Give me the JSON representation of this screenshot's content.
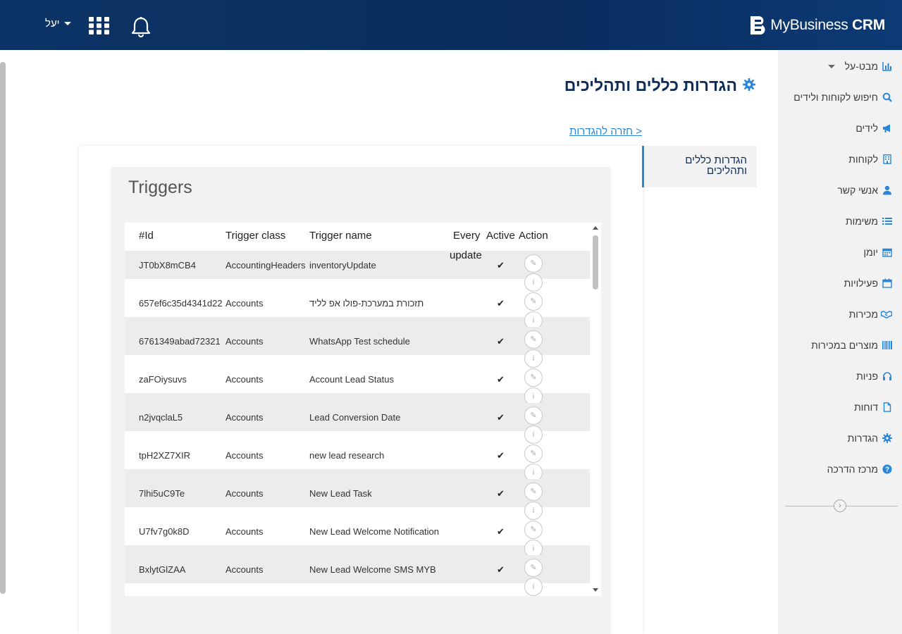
{
  "header": {
    "brand_main": "MyBusiness",
    "brand_bold": "CRM",
    "user_name": "יעל"
  },
  "sidebar": {
    "items": [
      {
        "label": "מבט-על",
        "icon": "bar-chart-icon"
      },
      {
        "label": "חיפוש לקוחות ולידים",
        "icon": "search-icon"
      },
      {
        "label": "לידים",
        "icon": "megaphone-icon"
      },
      {
        "label": "לקוחות",
        "icon": "building-icon"
      },
      {
        "label": "אנשי קשר",
        "icon": "user-icon"
      },
      {
        "label": "משימות",
        "icon": "list-icon"
      },
      {
        "label": "יומן",
        "icon": "calendar-icon"
      },
      {
        "label": "פעילויות",
        "icon": "calendar-icon"
      },
      {
        "label": "מכירות",
        "icon": "handshake-icon"
      },
      {
        "label": "מוצרים במכירות",
        "icon": "barcode-icon"
      },
      {
        "label": "פניות",
        "icon": "headset-icon"
      },
      {
        "label": "דוחות",
        "icon": "file-icon"
      },
      {
        "label": "הגדרות",
        "icon": "gear-icon"
      },
      {
        "label": "מרכז הדרכה",
        "icon": "question-icon"
      }
    ]
  },
  "page": {
    "title": "הגדרות כללים ותהליכים",
    "back_link": "< חזרה להגדרות",
    "sub_tab": "הגדרות כללים ותהליכים"
  },
  "card": {
    "title": "Triggers"
  },
  "table": {
    "columns": [
      "#Id",
      "Trigger class",
      "Trigger name",
      "Every update",
      "Active",
      "Action"
    ],
    "column_every_line1": "Every",
    "column_every_line2": "update",
    "rows": [
      {
        "id": "JT0bX8mCB4",
        "class": "AccountingHeaders",
        "name": "inventoryUpdate",
        "active": true
      },
      {
        "id": "657ef6c35d4341d22",
        "class": "Accounts",
        "name": "תזכורת במערכת-פולו אפ לליד",
        "active": true
      },
      {
        "id": "6761349abad72321",
        "class": "Accounts",
        "name": "WhatsApp Test schedule",
        "active": true
      },
      {
        "id": "zaFOiysuvs",
        "class": "Accounts",
        "name": "Account Lead Status",
        "active": true
      },
      {
        "id": "n2jvqclaL5",
        "class": "Accounts",
        "name": "Lead Conversion Date",
        "active": true
      },
      {
        "id": "tpH2XZ7XIR",
        "class": "Accounts",
        "name": "new lead research",
        "active": true
      },
      {
        "id": "7lhi5uC9Te",
        "class": "Accounts",
        "name": "New Lead Task",
        "active": true
      },
      {
        "id": "U7fv7g0k8D",
        "class": "Accounts",
        "name": "New Lead Welcome Notification",
        "active": true
      },
      {
        "id": "BxlytGlZAA",
        "class": "Accounts",
        "name": "New Lead Welcome SMS MYB",
        "active": true
      }
    ]
  },
  "colors": {
    "header_bg": "#0c3066",
    "accent": "#2a86d8",
    "title": "#0d2b55",
    "sidebar_bg": "#f2f2f2"
  }
}
